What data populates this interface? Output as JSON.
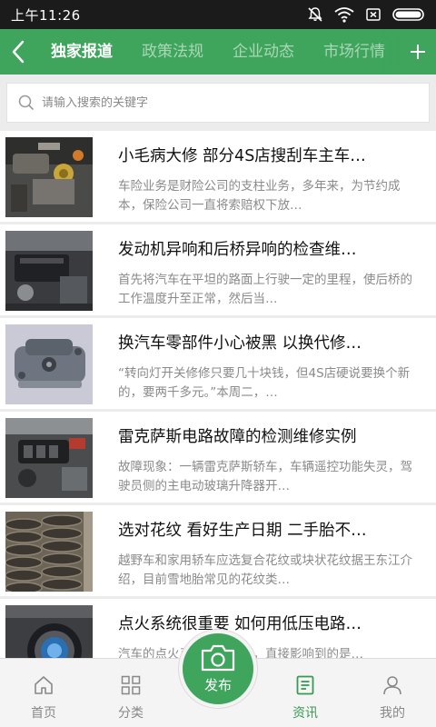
{
  "status_bar": {
    "time": "上午11:26"
  },
  "nav": {
    "tabs": [
      {
        "label": "独家报道",
        "active": true
      },
      {
        "label": "政策法规",
        "active": false
      },
      {
        "label": "企业动态",
        "active": false
      },
      {
        "label": "市场行情",
        "active": false
      }
    ]
  },
  "search": {
    "placeholder": "请输入搜索的关键字"
  },
  "news": [
    {
      "title": "小毛病大修 部分4S店搜刮车主车…",
      "summary": "车险业务是财险公司的支柱业务，多年来，为节约成本，保险公司一直将索赔权下放…",
      "thumb": "engine-bay"
    },
    {
      "title": "发动机异响和后桥异响的检查维…",
      "summary": "首先将汽车在平坦的路面上行驶一定的里程，使后桥的工作温度升至正常，然后当…",
      "thumb": "engine-top"
    },
    {
      "title": "换汽车零部件小心被黑 以换代修…",
      "summary": "“转向灯开关修修只要几十块钱，但4S店硬说要换个新的，要两千多元。”本周二，…",
      "thumb": "metal-part"
    },
    {
      "title": "雷克萨斯电路故障的检测维修实例",
      "summary": "故障现象：一辆雷克萨斯轿车，车辆遥控功能失灵，驾驶员侧的主电动玻璃升降器开…",
      "thumb": "engine-lexus"
    },
    {
      "title": "选对花纹 看好生产日期 二手胎不…",
      "summary": "越野车和家用轿车应选复合花纹或块状花纹据王东江介绍，目前雪地胎常见的花纹类…",
      "thumb": "tires"
    },
    {
      "title": "点火系统很重要 如何用低压电路…",
      "summary": "汽车的点火系统是否健康，直接影响到的是…",
      "thumb": "ignition"
    }
  ],
  "bottom_nav": {
    "home": "首页",
    "category": "分类",
    "publish": "发布",
    "news": "资讯",
    "mine": "我的"
  },
  "colors": {
    "primary": "#3fa55d",
    "status_bar": "#1b1b1b",
    "active_tab_text": "#ffffff"
  }
}
